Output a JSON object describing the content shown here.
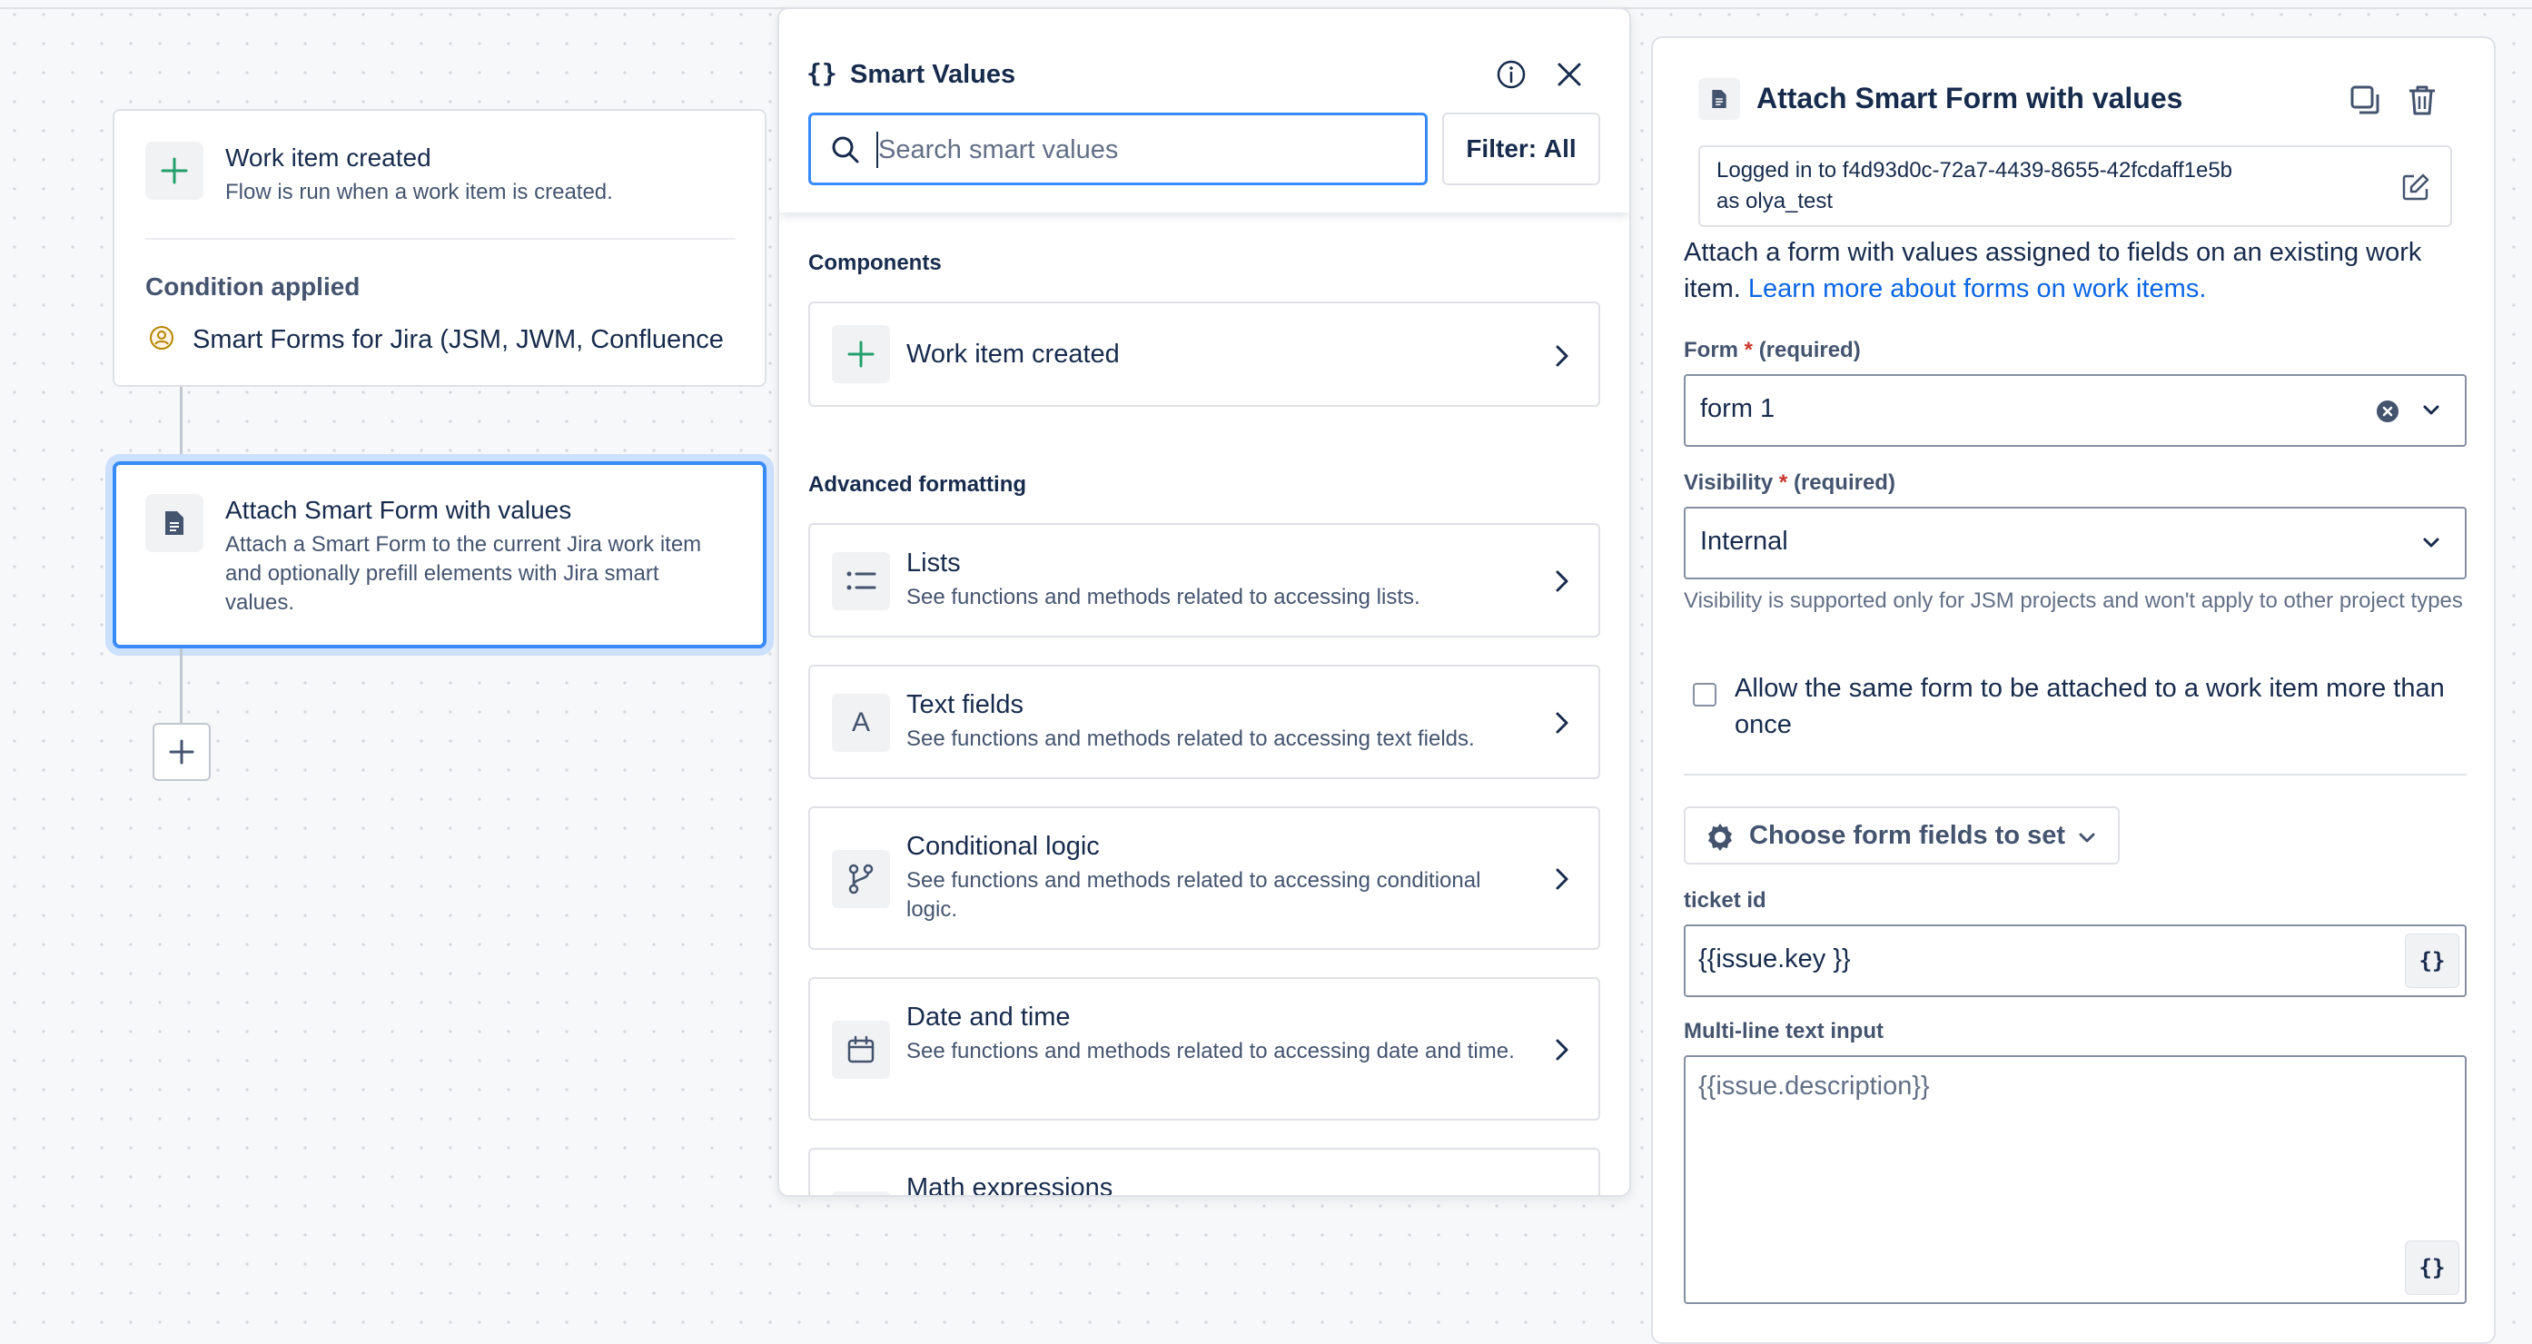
{
  "canvas": {
    "trigger": {
      "title": "Work item created",
      "subtitle": "Flow is run when a work item is created.",
      "condition_title": "Condition applied",
      "condition_item": "Smart Forms for Jira (JSM, JWM, Confluence"
    },
    "action": {
      "title": "Attach Smart Form with values",
      "subtitle": "Attach a Smart Form to the current Jira work item and optionally prefill elements with Jira smart values."
    }
  },
  "smart_values": {
    "title": "Smart Values",
    "search_placeholder": "Search smart values",
    "filter_label": "Filter:",
    "filter_value": "All",
    "sections": {
      "components": "Components",
      "advanced": "Advanced formatting"
    },
    "components": [
      {
        "title": "Work item created",
        "icon": "plus-icon"
      }
    ],
    "advanced": [
      {
        "title": "Lists",
        "description": "See functions and methods related to accessing lists.",
        "icon": "list-icon"
      },
      {
        "title": "Text fields",
        "description": "See functions and methods related to accessing text fields.",
        "icon": "text-icon"
      },
      {
        "title": "Conditional logic",
        "description": "See functions and methods related to accessing conditional logic.",
        "icon": "branch-icon"
      },
      {
        "title": "Date and time",
        "description": "See functions and methods related to accessing date and time.",
        "icon": "calendar-icon"
      },
      {
        "title": "Math expressions",
        "description": "",
        "icon": "math-icon"
      }
    ]
  },
  "config": {
    "title": "Attach Smart Form with values",
    "login_line1": "Logged in to f4d93d0c-72a7-4439-8655-42fcdaff1e5b",
    "login_line2": "as olya_test",
    "description": "Attach a form with values assigned to fields on an existing work item.",
    "learn_more": "Learn more about forms on work items.",
    "form_label": "Form",
    "form_required": "(required)",
    "form_value": "form 1",
    "visibility_label": "Visibility",
    "visibility_required": "(required)",
    "visibility_value": "Internal",
    "visibility_helper": "Visibility is supported only for JSM projects and won't apply to other project types",
    "checkbox_label": "Allow the same form to be attached to a work item more than once",
    "choose_fields": "Choose form fields to set",
    "ticket_id_label": "ticket id",
    "ticket_id_value": "{{issue.key }}",
    "multiline_label": "Multi-line text input",
    "multiline_value": "{{issue.description}}",
    "brace_glyph": "{}"
  },
  "colors": {
    "accent": "#388bff",
    "link": "#0c66e4",
    "required": "#c9372c",
    "green_plus": "#22a06b"
  }
}
